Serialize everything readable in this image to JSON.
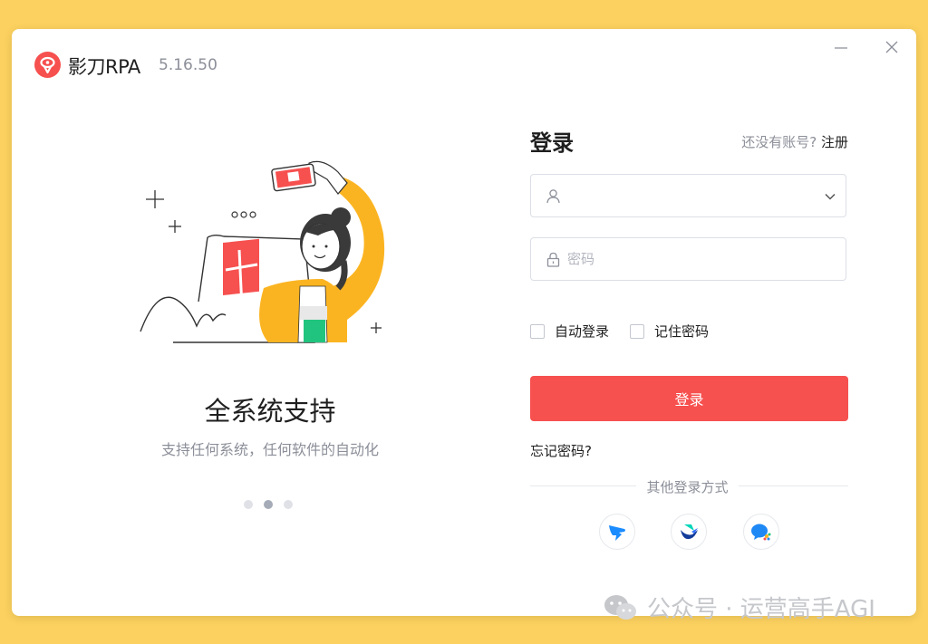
{
  "window": {
    "app_name": "影刀RPA",
    "version": "5.16.50"
  },
  "carousel": {
    "title": "全系统支持",
    "subtitle": "支持任何系统，任何软件的自动化",
    "slide_count": 3,
    "active_index": 1
  },
  "login": {
    "title": "登录",
    "no_account_text": "还没有账号?",
    "register_label": "注册",
    "username": {
      "value": "",
      "placeholder": ""
    },
    "password": {
      "value": "",
      "placeholder": "密码"
    },
    "auto_login_label": "自动登录",
    "remember_password_label": "记住密码",
    "auto_login_checked": false,
    "remember_password_checked": false,
    "submit_label": "登录",
    "forgot_label": "忘记密码?",
    "other_methods_label": "其他登录方式",
    "social_icons": [
      "dingtalk-icon",
      "feishu-icon",
      "wecom-icon"
    ]
  },
  "watermark": {
    "text": "公众号 · 运营高手AGI"
  },
  "colors": {
    "background": "#FCD15F",
    "primary": "#F6504F",
    "text": "#1F1F1F",
    "muted": "#8C8F99"
  }
}
